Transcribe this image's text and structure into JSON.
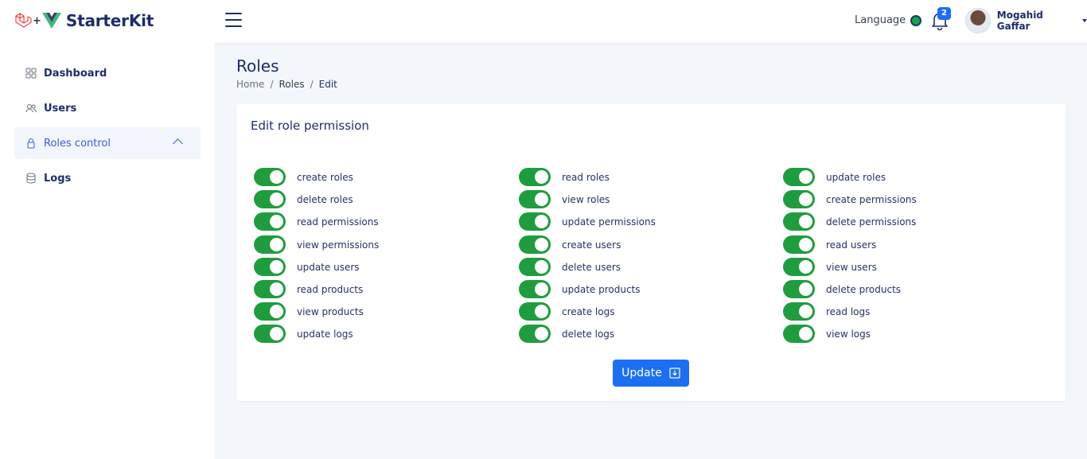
{
  "brand": {
    "name": "StarterKit",
    "plus": "+"
  },
  "topbar": {
    "language_label": "Language",
    "notification_count": "2",
    "user_name": "Mogahid Gaffar"
  },
  "sidebar": {
    "items": [
      {
        "label": "Dashboard",
        "icon": "grid-icon",
        "active": false
      },
      {
        "label": "Users",
        "icon": "users-icon",
        "active": false
      },
      {
        "label": "Roles control",
        "icon": "lock-icon",
        "active": true
      },
      {
        "label": "Logs",
        "icon": "database-icon",
        "active": false
      }
    ]
  },
  "page": {
    "title": "Roles",
    "breadcrumb": [
      "Home",
      "Roles",
      "Edit"
    ]
  },
  "card": {
    "title": "Edit role permission",
    "permissions": [
      {
        "label": "create roles",
        "enabled": true
      },
      {
        "label": "read roles",
        "enabled": true
      },
      {
        "label": "update roles",
        "enabled": true
      },
      {
        "label": "delete roles",
        "enabled": true
      },
      {
        "label": "view roles",
        "enabled": true
      },
      {
        "label": "create permissions",
        "enabled": true
      },
      {
        "label": "read permissions",
        "enabled": true
      },
      {
        "label": "update permissions",
        "enabled": true
      },
      {
        "label": "delete permissions",
        "enabled": true
      },
      {
        "label": "view permissions",
        "enabled": true
      },
      {
        "label": "create users",
        "enabled": true
      },
      {
        "label": "read users",
        "enabled": true
      },
      {
        "label": "update users",
        "enabled": true
      },
      {
        "label": "delete users",
        "enabled": true
      },
      {
        "label": "view users",
        "enabled": true
      },
      {
        "label": "read products",
        "enabled": true
      },
      {
        "label": "update products",
        "enabled": true
      },
      {
        "label": "delete products",
        "enabled": true
      },
      {
        "label": "view products",
        "enabled": true
      },
      {
        "label": "create logs",
        "enabled": true
      },
      {
        "label": "read logs",
        "enabled": true
      },
      {
        "label": "update logs",
        "enabled": true
      },
      {
        "label": "delete logs",
        "enabled": true
      },
      {
        "label": "view logs",
        "enabled": true
      }
    ],
    "update_label": "Update"
  },
  "colors": {
    "accent": "#1d6ff2",
    "toggle_on": "#1f9d3e",
    "brand_text": "#1d2d6b",
    "active_nav": "#3b5bdb"
  }
}
